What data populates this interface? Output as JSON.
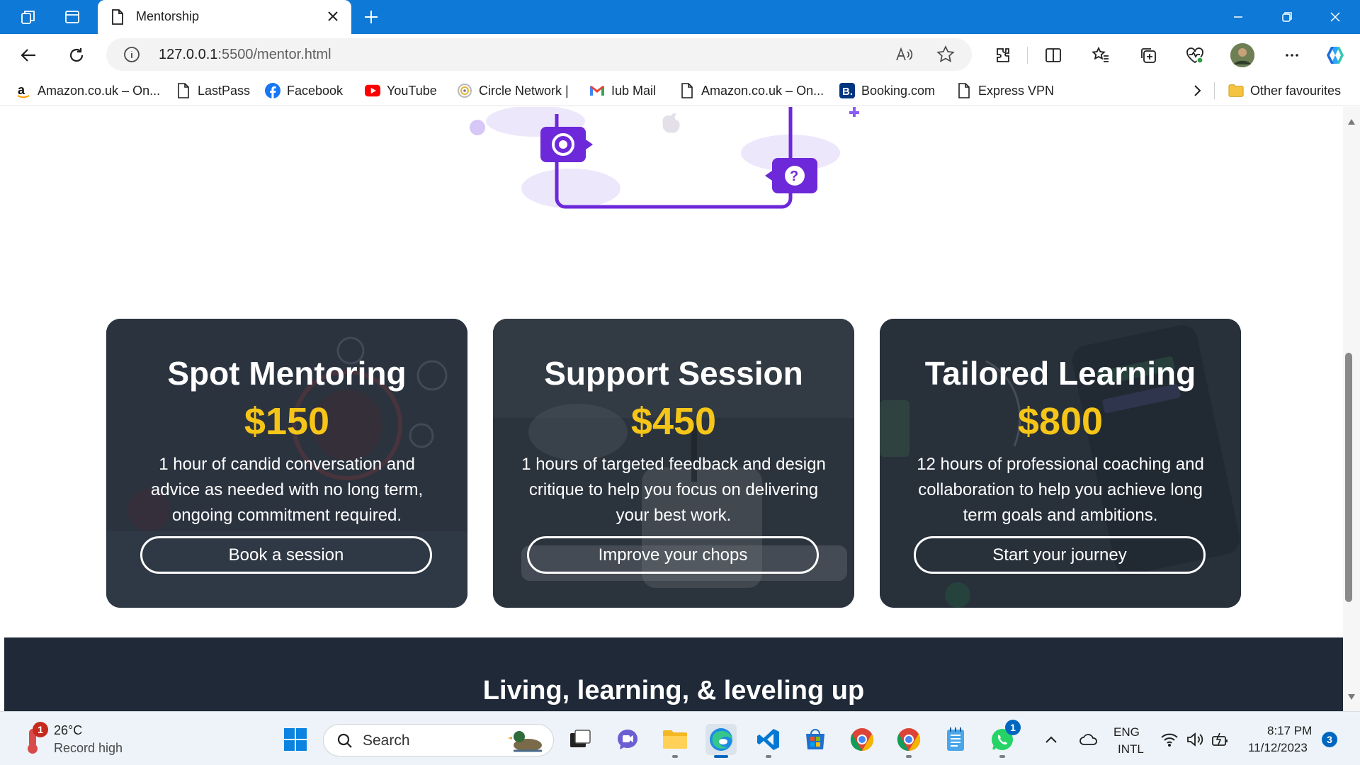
{
  "browser": {
    "tab_title": "Mentorship",
    "url_host": "127.0.0.1",
    "url_path": ":5500/mentor.html",
    "favourites": [
      {
        "label": "Amazon.co.uk – On...",
        "icon": "amazon-icon"
      },
      {
        "label": "LastPass",
        "icon": "page-icon"
      },
      {
        "label": "Facebook",
        "icon": "facebook-icon"
      },
      {
        "label": "YouTube",
        "icon": "youtube-icon"
      },
      {
        "label": "Circle Network |",
        "icon": "circle-network-icon"
      },
      {
        "label": "Iub Mail",
        "icon": "gmail-icon"
      },
      {
        "label": "Amazon.co.uk – On...",
        "icon": "page-icon"
      },
      {
        "label": "Booking.com",
        "icon": "booking-icon"
      },
      {
        "label": "Express VPN",
        "icon": "page-icon"
      }
    ],
    "other_favourites": "Other favourites"
  },
  "page": {
    "cards": [
      {
        "title": "Spot Mentoring",
        "price": "$150",
        "description": "1 hour of candid conversation and advice as needed with no long term, ongoing commitment required.",
        "button": "Book a session"
      },
      {
        "title": "Support Session",
        "price": "$450",
        "description": "1 hours of targeted feedback and design critique to help you focus on delivering your best work.",
        "button": "Improve your chops"
      },
      {
        "title": "Tailored Learning",
        "price": "$800",
        "description": "12 hours of professional coaching and collaboration to help you achieve long term goals and ambitions.",
        "button": "Start your journey"
      }
    ],
    "footer_heading": "Living, learning, & leveling up",
    "colors": {
      "price": "#f5c518",
      "accent_purple": "#6d28d9",
      "footer_bg": "#1f2937"
    }
  },
  "taskbar": {
    "weather_temp": "26°C",
    "weather_status": "Record high",
    "weather_badge": "1",
    "search_label": "Search",
    "whatsapp_badge": "1",
    "lang_line1": "ENG",
    "lang_line2": "INTL",
    "time": "8:17 PM",
    "date": "11/12/2023",
    "notification_count": "3"
  }
}
